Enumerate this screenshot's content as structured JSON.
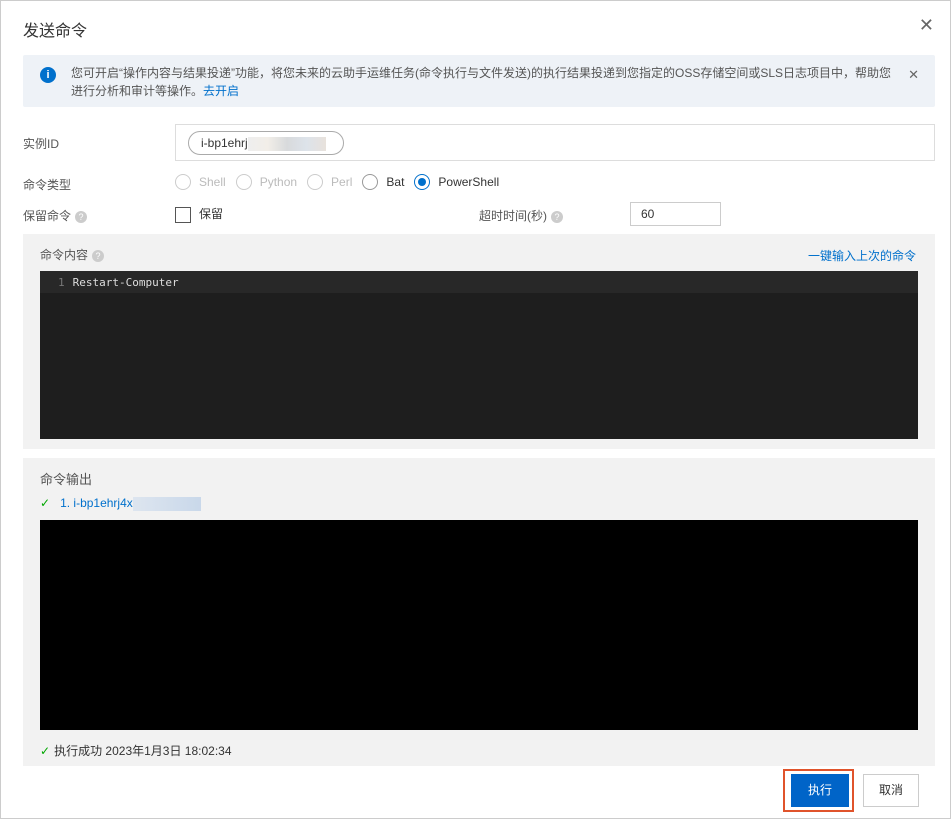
{
  "dialog": {
    "title": "发送命令",
    "close_icon": "close-icon"
  },
  "alert": {
    "text": "您可开启“操作内容与结果投递”功能，将您未来的云助手运维任务(命令执行与文件发送)的执行结果投递到您指定的OSS存储空间或SLS日志项目中，帮助您进行分析和审计等操作。",
    "link": "去开启"
  },
  "form": {
    "instance_label": "实例ID",
    "instance_tag": "i-bp1ehrj",
    "type_label": "命令类型",
    "types": [
      "Shell",
      "Python",
      "Perl",
      "Bat",
      "PowerShell"
    ],
    "selected_type": "PowerShell",
    "keep_label": "保留命令",
    "keep_checkbox": "保留",
    "keep_checked": false,
    "timeout_label": "超时时间(秒)",
    "timeout_value": "60"
  },
  "content": {
    "label": "命令内容",
    "last_link": "一键输入上次的命令",
    "lines": [
      {
        "num": "1",
        "code": "Restart-Computer"
      }
    ]
  },
  "output": {
    "label": "命令输出",
    "item": "1.  i-bp1ehrj4x",
    "status": "执行成功",
    "time": "2023年1月3日 18:02:34"
  },
  "footer": {
    "execute": "执行",
    "cancel": "取消"
  },
  "colors": {
    "accent": "#0070cc",
    "success": "#00a700",
    "highlight": "#e0532b"
  }
}
